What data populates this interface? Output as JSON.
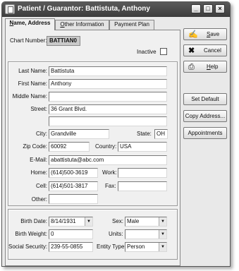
{
  "window": {
    "title": "Patient / Guarantor: Battistuta, Anthony",
    "controls": [
      "_",
      "□",
      "×"
    ]
  },
  "tabs": [
    {
      "label_u": "N",
      "label_rest": "ame, Address",
      "active": true
    },
    {
      "label_u": "O",
      "label_rest": "ther Information",
      "active": false
    },
    {
      "label_u": "",
      "label_rest": "Payment Plan",
      "active": false
    }
  ],
  "header": {
    "chart_number_label": "Chart Number:",
    "chart_number": "BATTIAN0",
    "inactive_label": "Inactive",
    "inactive_checked": false
  },
  "address": {
    "last_name_label": "Last Name:",
    "last_name": "Battistuta",
    "first_name_label": "First Name:",
    "first_name": "Anthony",
    "middle_name_label": "Middle Name:",
    "middle_name": "",
    "street_label": "Street:",
    "street1": "36 Grant Blvd.",
    "street2": "",
    "city_label": "City:",
    "city": "Grandville",
    "state_label": "State:",
    "state": "OH",
    "zip_label": "Zip Code:",
    "zip": "60092",
    "country_label": "Country:",
    "country": "USA",
    "email_label": "E-Mail:",
    "email": "abattistuta@abc.com",
    "home_label": "Home:",
    "home": "(614)500-3619",
    "work_label": "Work:",
    "work": "",
    "cell_label": "Cell:",
    "cell": "(614)501-3817",
    "fax_label": "Fax:",
    "fax": "",
    "other_label": "Other:",
    "other": ""
  },
  "demographics": {
    "birth_date_label": "Birth Date:",
    "birth_date": "8/14/1931",
    "sex_label": "Sex:",
    "sex": "Male",
    "birth_weight_label": "Birth Weight:",
    "birth_weight": "0",
    "units_label": "Units:",
    "units": "",
    "ssn_label": "Social Security:",
    "ssn": "239-55-0855",
    "entity_type_label": "Entity Type:",
    "entity_type": "Person"
  },
  "side_buttons": {
    "save_u": "S",
    "save_rest": "ave",
    "cancel": "Cancel",
    "help_u": "H",
    "help_rest": "elp",
    "set_default": "Set Default",
    "copy_address": "Copy Address...",
    "appointments": "Appointments"
  },
  "icons": {
    "save": "save-icon",
    "cancel": "cancel-x-icon",
    "help": "help-printer-icon"
  }
}
